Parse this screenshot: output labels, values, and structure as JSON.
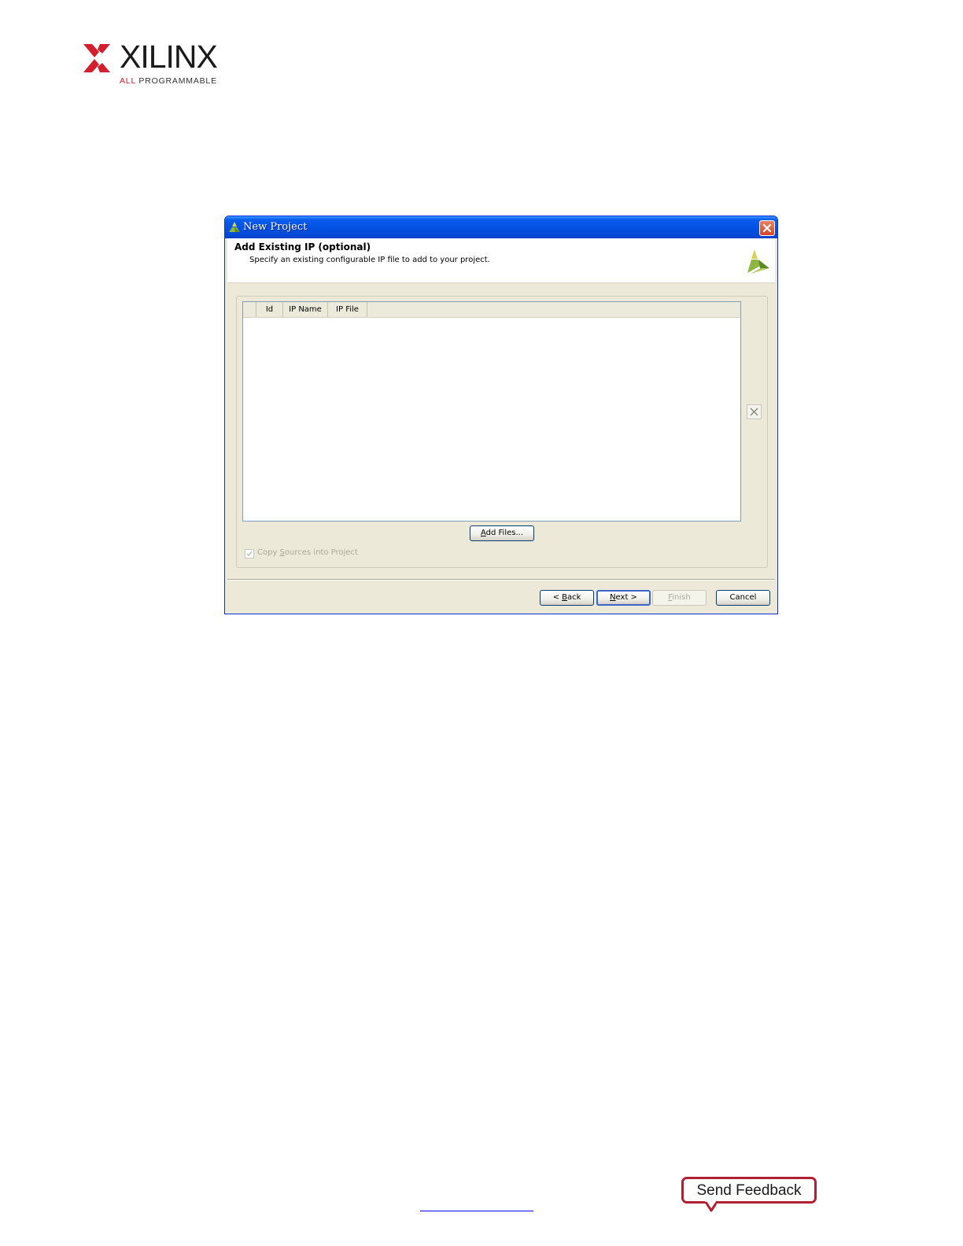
{
  "logo": {
    "wordmark": "XILINX",
    "tagline_all": "ALL",
    "tagline_rest": "PROGRAMMABLE",
    "brand_color": "#d2202f"
  },
  "dialog": {
    "title": "New Project",
    "close_icon": "close-icon",
    "header": {
      "title": "Add Existing IP (optional)",
      "description": "Specify an existing configurable IP file to add to your project.",
      "logo_icon": "vivado-logo-icon"
    },
    "table": {
      "columns": [
        "",
        "Id",
        "IP Name",
        "IP File"
      ],
      "rows": []
    },
    "remove_icon": "remove-icon",
    "add_files_button": {
      "mnemonic": "A",
      "rest": "dd Files..."
    },
    "copy_sources": {
      "checked": true,
      "enabled": false,
      "label_pre": "Copy ",
      "label_mnemonic": "S",
      "label_post": "ources into Project"
    },
    "buttons": {
      "back": {
        "pre": "< ",
        "mnemonic": "B",
        "post": "ack"
      },
      "next": {
        "mnemonic": "N",
        "post": "ext >"
      },
      "finish": {
        "mnemonic": "F",
        "post": "inish"
      },
      "cancel": "Cancel"
    }
  },
  "footer": {
    "send_feedback": "Send Feedback",
    "feedback_color": "#b02030"
  }
}
